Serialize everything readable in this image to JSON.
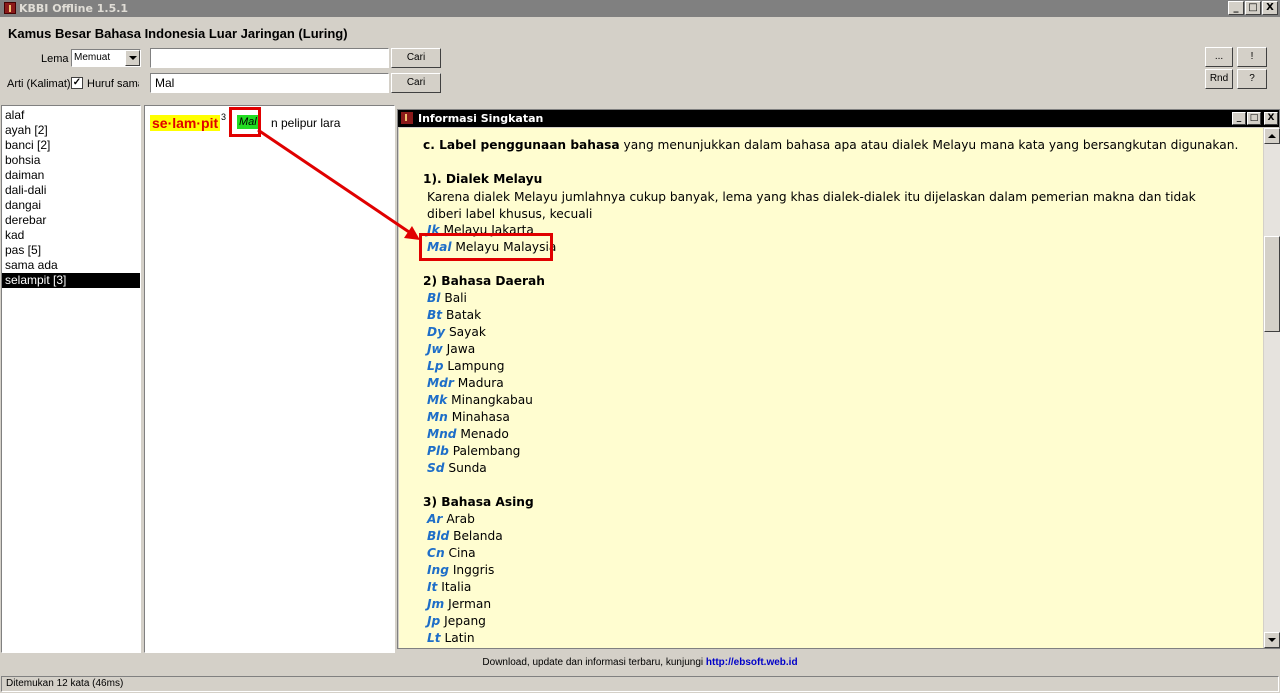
{
  "window": {
    "title": "KBBI Offline 1.5.1",
    "min": "_",
    "max": "□",
    "close": "X"
  },
  "app_heading": "Kamus Besar Bahasa Indonesia Luar Jaringan (Luring)",
  "search": {
    "lema_label": "Lema",
    "lema_mode": "Memuat",
    "lema_value": "",
    "arti_label": "Arti (Kalimat)",
    "huruf_sama_label": "Huruf sama",
    "huruf_sama_checked": "✓",
    "arti_value": "Mal",
    "cari_label": "Cari"
  },
  "right_buttons": {
    "more": "...",
    "excl": "!",
    "rnd": "Rnd",
    "help": "?"
  },
  "word_list": [
    "alaf",
    "ayah [2]",
    "banci [2]",
    "bohsia",
    "daiman",
    "dali-dali",
    "dangai",
    "derebar",
    "kad",
    "pas [5]",
    "sama ada",
    "selampit [3]"
  ],
  "entry": {
    "headword": "se·lam·pit",
    "superscript": "3",
    "label": "Mal",
    "definition": "n pelipur lara"
  },
  "info_window": {
    "title": "Informasi Singkatan",
    "intro_bold": "c. Label penggunaan bahasa",
    "intro_rest": " yang menunjukkan dalam bahasa apa atau dialek Melayu mana kata yang bersangkutan digunakan.",
    "sec1": "1). Dialek Melayu",
    "sec1_para": "Karena dialek Melayu jumlahnya cukup banyak, lema yang khas dialek-dialek itu dijelaskan dalam pemerian makna dan tidak diberi label khusus, kecuali",
    "sec1_items": [
      {
        "abbr": "Jk",
        "name": "Melayu Jakarta"
      },
      {
        "abbr": "Mal",
        "name": "Melayu Malaysia"
      }
    ],
    "sec2": "2) Bahasa Daerah",
    "sec2_items": [
      {
        "abbr": "Bl",
        "name": "Bali"
      },
      {
        "abbr": "Bt",
        "name": "Batak"
      },
      {
        "abbr": "Dy",
        "name": "Sayak"
      },
      {
        "abbr": "Jw",
        "name": "Jawa"
      },
      {
        "abbr": "Lp",
        "name": "Lampung"
      },
      {
        "abbr": "Mdr",
        "name": "Madura"
      },
      {
        "abbr": "Mk",
        "name": "Minangkabau"
      },
      {
        "abbr": "Mn",
        "name": "Minahasa"
      },
      {
        "abbr": "Mnd",
        "name": "Menado"
      },
      {
        "abbr": "Plb",
        "name": "Palembang"
      },
      {
        "abbr": "Sd",
        "name": "Sunda"
      }
    ],
    "sec3": "3) Bahasa Asing",
    "sec3_items": [
      {
        "abbr": "Ar",
        "name": "Arab"
      },
      {
        "abbr": "Bld",
        "name": "Belanda"
      },
      {
        "abbr": "Cn",
        "name": "Cina"
      },
      {
        "abbr": "Ing",
        "name": "Inggris"
      },
      {
        "abbr": "It",
        "name": "Italia"
      },
      {
        "abbr": "Jm",
        "name": "Jerman"
      },
      {
        "abbr": "Jp",
        "name": "Jepang"
      },
      {
        "abbr": "Lt",
        "name": "Latin"
      }
    ]
  },
  "footer": {
    "text": "Download, update dan informasi terbaru, kunjungi ",
    "link": "http://ebsoft.web.id"
  },
  "status": "Ditemukan 12 kata (46ms)",
  "colors": {
    "headword_bg": "#ffff00",
    "headword_fg": "#e00000",
    "label_bg": "#22dd22",
    "abbr": "#1e6ec8",
    "info_bg": "#fffdd0",
    "highlight": "#e00000"
  }
}
